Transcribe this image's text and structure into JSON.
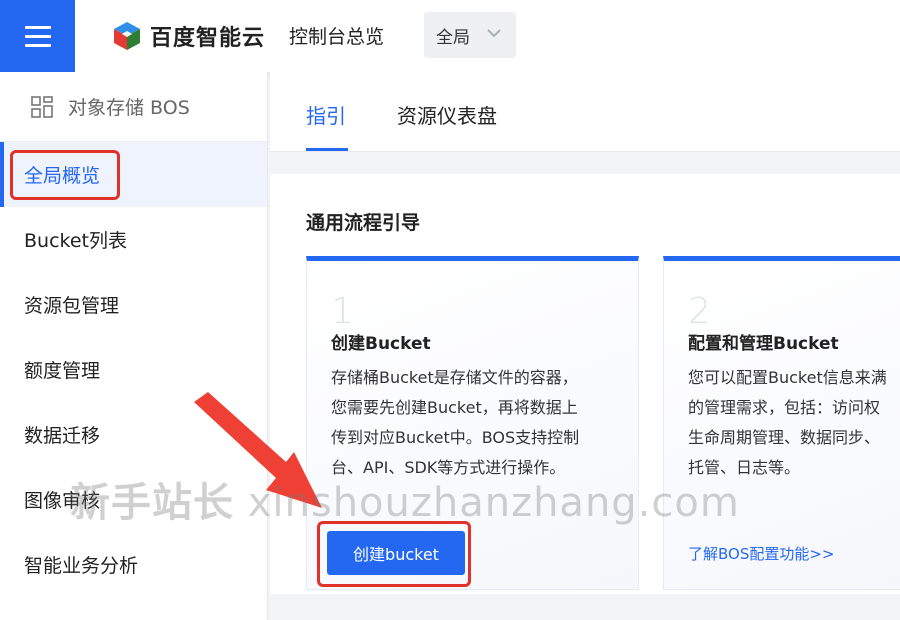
{
  "header": {
    "logo_text": "百度智能云",
    "console_title": "控制台总览",
    "region": "全局"
  },
  "sidebar": {
    "title": "对象存储 BOS",
    "items": [
      {
        "label": "全局概览",
        "active": true
      },
      {
        "label": "Bucket列表"
      },
      {
        "label": "资源包管理"
      },
      {
        "label": "额度管理"
      },
      {
        "label": "数据迁移"
      },
      {
        "label": "图像审核"
      },
      {
        "label": "智能业务分析"
      }
    ]
  },
  "tabs": [
    {
      "label": "指引",
      "active": true
    },
    {
      "label": "资源仪表盘"
    }
  ],
  "guide": {
    "title": "通用流程引导",
    "cards": [
      {
        "number": "1",
        "title": "创建Bucket",
        "desc_lines": [
          "存储桶Bucket是存储文件的容器，",
          "您需要先创建Bucket，再将数据上",
          "传到对应Bucket中。BOS支持控制",
          "台、API、SDK等方式进行操作。"
        ],
        "button": "创建bucket"
      },
      {
        "number": "2",
        "title": "配置和管理Bucket",
        "desc_lines": [
          "您可以配置Bucket信息来满",
          "的管理需求，包括：访问权",
          "生命周期管理、数据同步、",
          "托管、日志等。"
        ],
        "link": "了解BOS配置功能>>"
      }
    ]
  },
  "watermark": {
    "cn": "新手站长",
    "en": "xinshouzhanzhang.com"
  },
  "colors": {
    "brand": "#2468f2",
    "annotation": "#e0322b"
  }
}
